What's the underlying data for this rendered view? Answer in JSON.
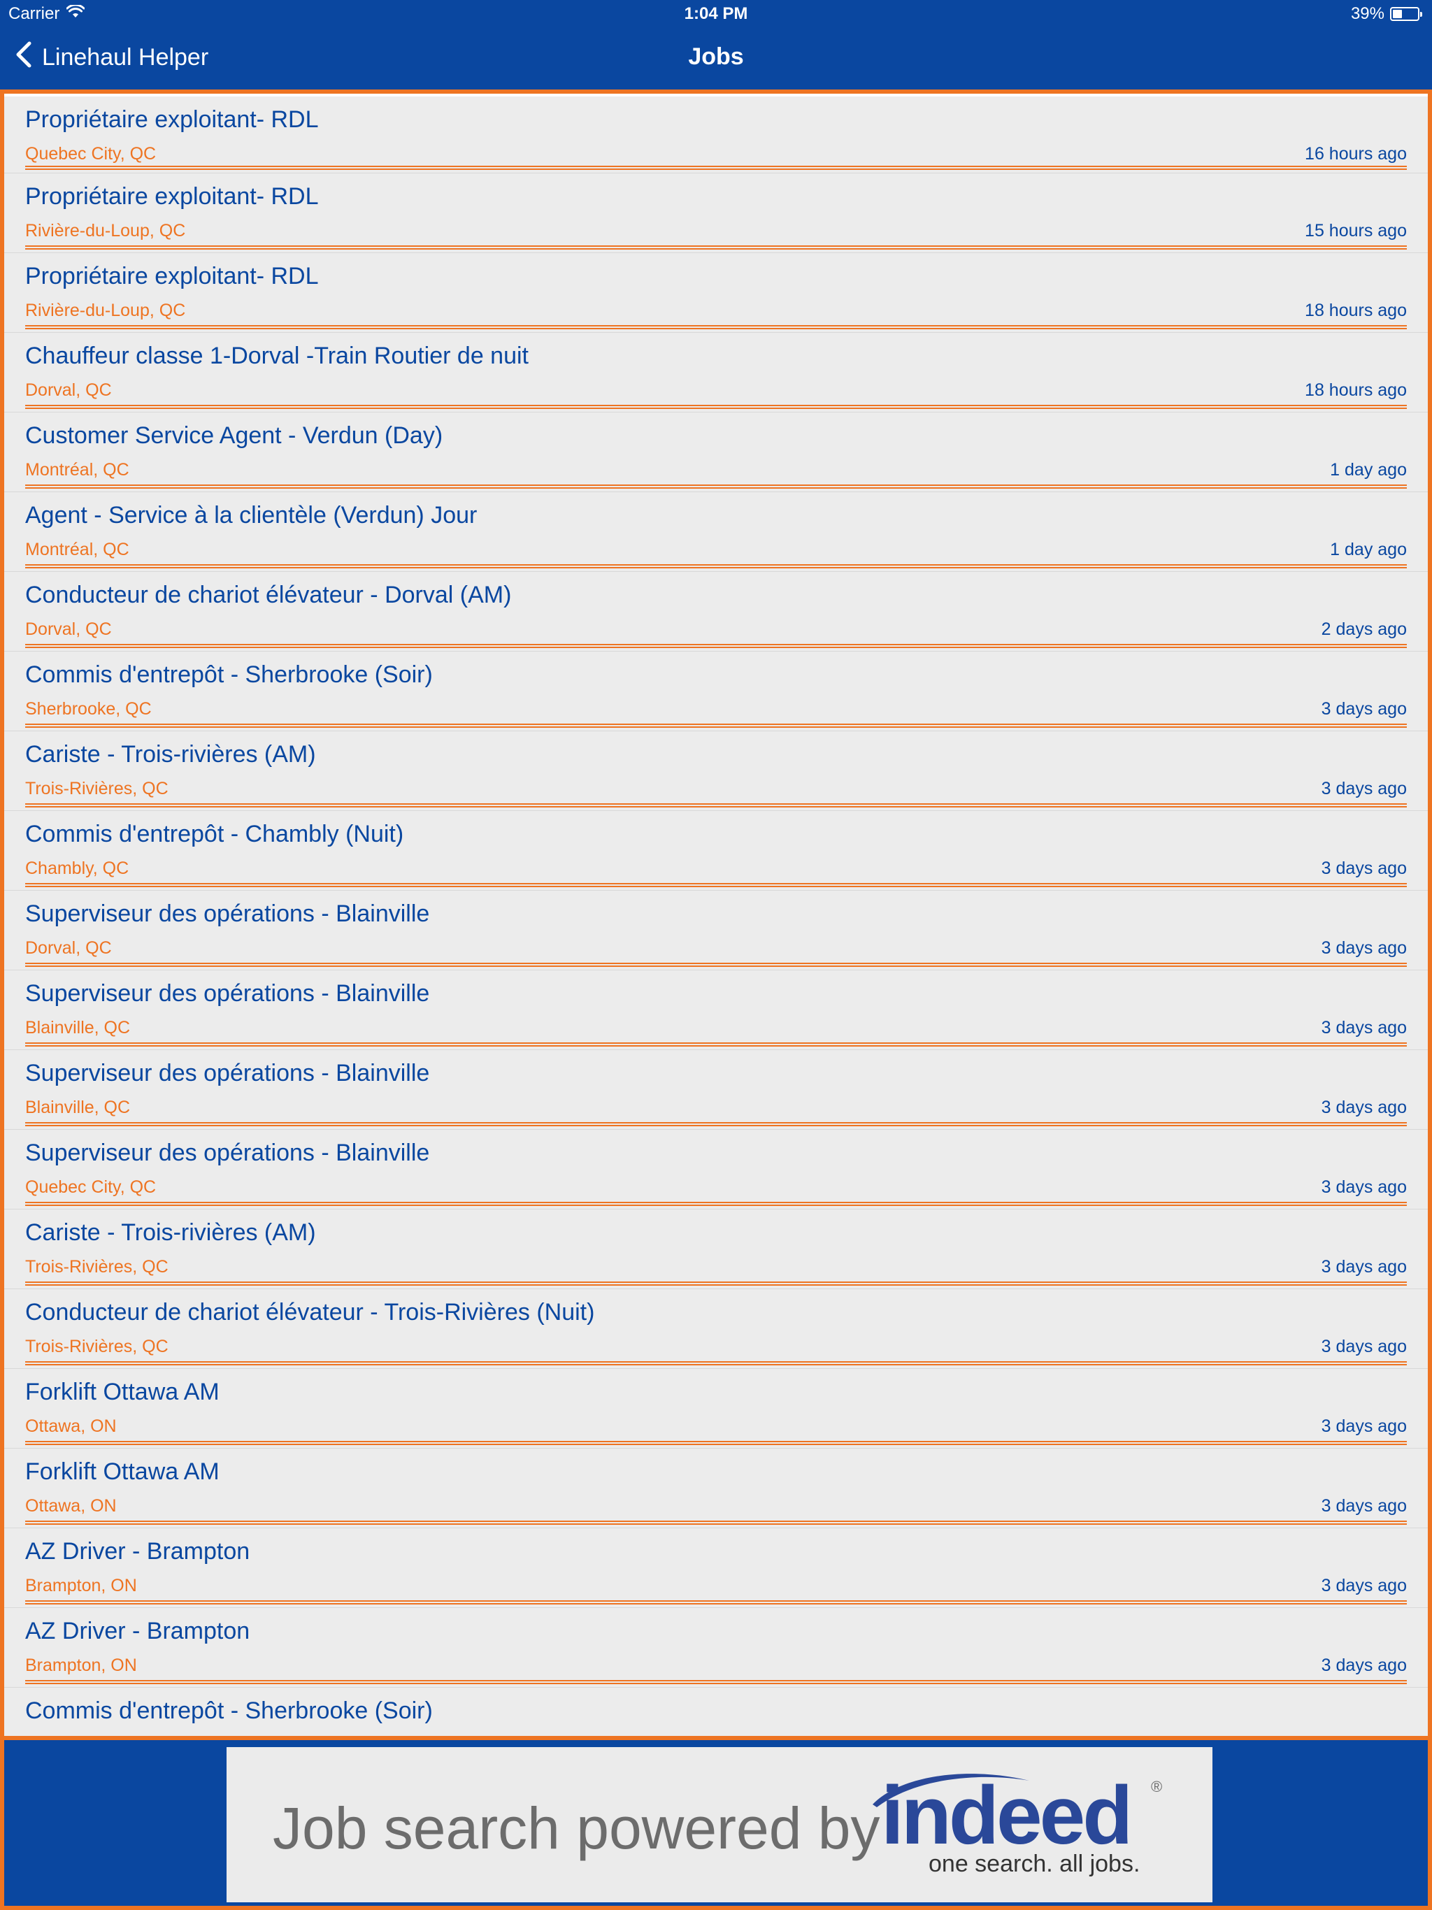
{
  "status_bar": {
    "carrier": "Carrier",
    "time": "1:04 PM",
    "battery_percent": "39%",
    "battery_level": 0.39
  },
  "nav": {
    "back_label": "Linehaul Helper",
    "title": "Jobs"
  },
  "jobs": [
    {
      "title": "Propriétaire exploitant- RDL",
      "location": "Quebec City, QC",
      "posted": "16 hours ago"
    },
    {
      "title": "Propriétaire exploitant- RDL",
      "location": "Rivière-du-Loup, QC",
      "posted": "15 hours ago"
    },
    {
      "title": "Propriétaire exploitant- RDL",
      "location": "Rivière-du-Loup, QC",
      "posted": "18 hours ago"
    },
    {
      "title": "Chauffeur classe 1-Dorval -Train Routier de nuit",
      "location": "Dorval, QC",
      "posted": "18 hours ago"
    },
    {
      "title": "Customer Service Agent - Verdun (Day)",
      "location": "Montréal, QC",
      "posted": "1 day ago"
    },
    {
      "title": "Agent - Service à la clientèle (Verdun) Jour",
      "location": "Montréal, QC",
      "posted": "1 day ago"
    },
    {
      "title": "Conducteur de chariot élévateur - Dorval (AM)",
      "location": "Dorval, QC",
      "posted": "2 days ago"
    },
    {
      "title": "Commis d'entrepôt - Sherbrooke (Soir)",
      "location": "Sherbrooke, QC",
      "posted": "3 days ago"
    },
    {
      "title": "Cariste - Trois-rivières (AM)",
      "location": "Trois-Rivières, QC",
      "posted": "3 days ago"
    },
    {
      "title": "Commis d'entrepôt - Chambly (Nuit)",
      "location": "Chambly, QC",
      "posted": "3 days ago"
    },
    {
      "title": "Superviseur des opérations - Blainville",
      "location": "Dorval, QC",
      "posted": "3 days ago"
    },
    {
      "title": "Superviseur des opérations - Blainville",
      "location": "Blainville, QC",
      "posted": "3 days ago"
    },
    {
      "title": "Superviseur des opérations - Blainville",
      "location": "Blainville, QC",
      "posted": "3 days ago"
    },
    {
      "title": "Superviseur des opérations - Blainville",
      "location": "Quebec City, QC",
      "posted": "3 days ago"
    },
    {
      "title": "Cariste - Trois-rivières (AM)",
      "location": "Trois-Rivières, QC",
      "posted": "3 days ago"
    },
    {
      "title": "Conducteur de chariot élévateur - Trois-Rivières (Nuit)",
      "location": "Trois-Rivières, QC",
      "posted": "3 days ago"
    },
    {
      "title": "Forklift Ottawa AM",
      "location": "Ottawa, ON",
      "posted": "3 days ago"
    },
    {
      "title": "Forklift Ottawa AM",
      "location": "Ottawa, ON",
      "posted": "3 days ago"
    },
    {
      "title": "AZ Driver - Brampton",
      "location": "Brampton, ON",
      "posted": "3 days ago"
    },
    {
      "title": "AZ Driver - Brampton",
      "location": "Brampton, ON",
      "posted": "3 days ago"
    },
    {
      "title": "Commis d'entrepôt - Sherbrooke (Soir)",
      "location": "",
      "posted": ""
    }
  ],
  "footer": {
    "banner_text": "Job search powered by",
    "logo_word": "indeed",
    "logo_tagline": "one search. all jobs.",
    "logo_registered": "®"
  },
  "colors": {
    "brand_blue": "#0a47a0",
    "accent_orange": "#ee7422",
    "list_background": "#ececec",
    "indeed_blue": "#2a4899"
  },
  "icons": {
    "back": "chevron-left-icon",
    "wifi": "wifi-icon",
    "battery": "battery-icon"
  }
}
